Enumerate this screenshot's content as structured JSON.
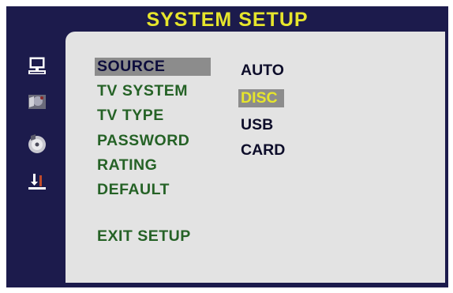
{
  "window": {
    "title": "SYSTEM SETUP"
  },
  "sidebar": {
    "icons": [
      {
        "name": "system-monitor-icon"
      },
      {
        "name": "language-icon"
      },
      {
        "name": "audio-disc-icon"
      },
      {
        "name": "preference-icon"
      }
    ]
  },
  "menu": {
    "items": [
      {
        "label": "SOURCE",
        "selected": true
      },
      {
        "label": "TV SYSTEM"
      },
      {
        "label": "TV TYPE"
      },
      {
        "label": "PASSWORD"
      },
      {
        "label": "RATING"
      },
      {
        "label": "DEFAULT"
      }
    ],
    "exit_label": "EXIT SETUP"
  },
  "options": {
    "items": [
      {
        "label": "AUTO"
      },
      {
        "label": "DISC",
        "highlighted": true
      },
      {
        "label": "USB"
      },
      {
        "label": "CARD"
      }
    ]
  },
  "colors": {
    "background": "#1c1b4c",
    "panel": "#e3e3e3",
    "title": "#e6e52c",
    "menu_text": "#256226",
    "selection": "#8c8c8c"
  }
}
